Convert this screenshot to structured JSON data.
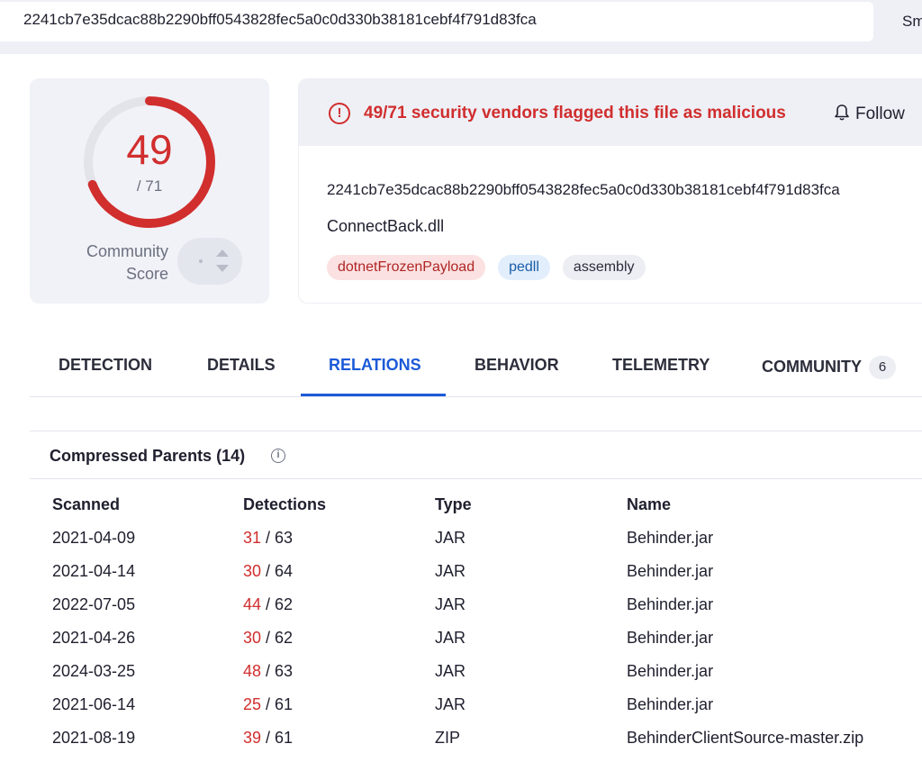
{
  "search": {
    "value": "2241cb7e35dcac88b2290bff0543828fec5a0c0d330b38181cebf4f791d83fca",
    "suffix_text": "Sm"
  },
  "score": {
    "positives": 49,
    "positives_label": "49",
    "total_label": "/ 71",
    "detection_fraction": 0.69,
    "community_label_line1": "Community",
    "community_label_line2": "Score"
  },
  "alert": {
    "text": "49/71 security vendors flagged this file as malicious",
    "follow_label": "Follow"
  },
  "file": {
    "hash": "2241cb7e35dcac88b2290bff0543828fec5a0c0d330b38181cebf4f791d83fca",
    "name": "ConnectBack.dll",
    "tags": [
      "dotnetFrozenPayload",
      "pedll",
      "assembly"
    ]
  },
  "tabs": {
    "detection": "DETECTION",
    "details": "DETAILS",
    "relations": "RELATIONS",
    "behavior": "BEHAVIOR",
    "telemetry": "TELEMETRY",
    "community": "COMMUNITY",
    "community_count": "6",
    "active": "RELATIONS"
  },
  "section": {
    "title": "Compressed Parents  (14)",
    "info_icon": "ⓘ"
  },
  "table": {
    "headers": {
      "scanned": "Scanned",
      "detections": "Detections",
      "type": "Type",
      "name": "Name"
    },
    "rows": [
      {
        "scanned": "2021-04-09",
        "positives": "31",
        "total": "/ 63",
        "type": "JAR",
        "name": "Behinder.jar"
      },
      {
        "scanned": "2021-04-14",
        "positives": "30",
        "total": "/ 64",
        "type": "JAR",
        "name": "Behinder.jar"
      },
      {
        "scanned": "2022-07-05",
        "positives": "44",
        "total": "/ 62",
        "type": "JAR",
        "name": "Behinder.jar"
      },
      {
        "scanned": "2021-04-26",
        "positives": "30",
        "total": "/ 62",
        "type": "JAR",
        "name": "Behinder.jar"
      },
      {
        "scanned": "2024-03-25",
        "positives": "48",
        "total": "/ 63",
        "type": "JAR",
        "name": "Behinder.jar"
      },
      {
        "scanned": "2021-06-14",
        "positives": "25",
        "total": "/ 61",
        "type": "JAR",
        "name": "Behinder.jar"
      },
      {
        "scanned": "2021-08-19",
        "positives": "39",
        "total": "/ 61",
        "type": "ZIP",
        "name": "BehinderClientSource-master.zip"
      }
    ]
  },
  "colors": {
    "malicious_red": "#d12e2e",
    "accent_blue": "#1c5ad8",
    "panel_gray": "#f1f2f7"
  }
}
